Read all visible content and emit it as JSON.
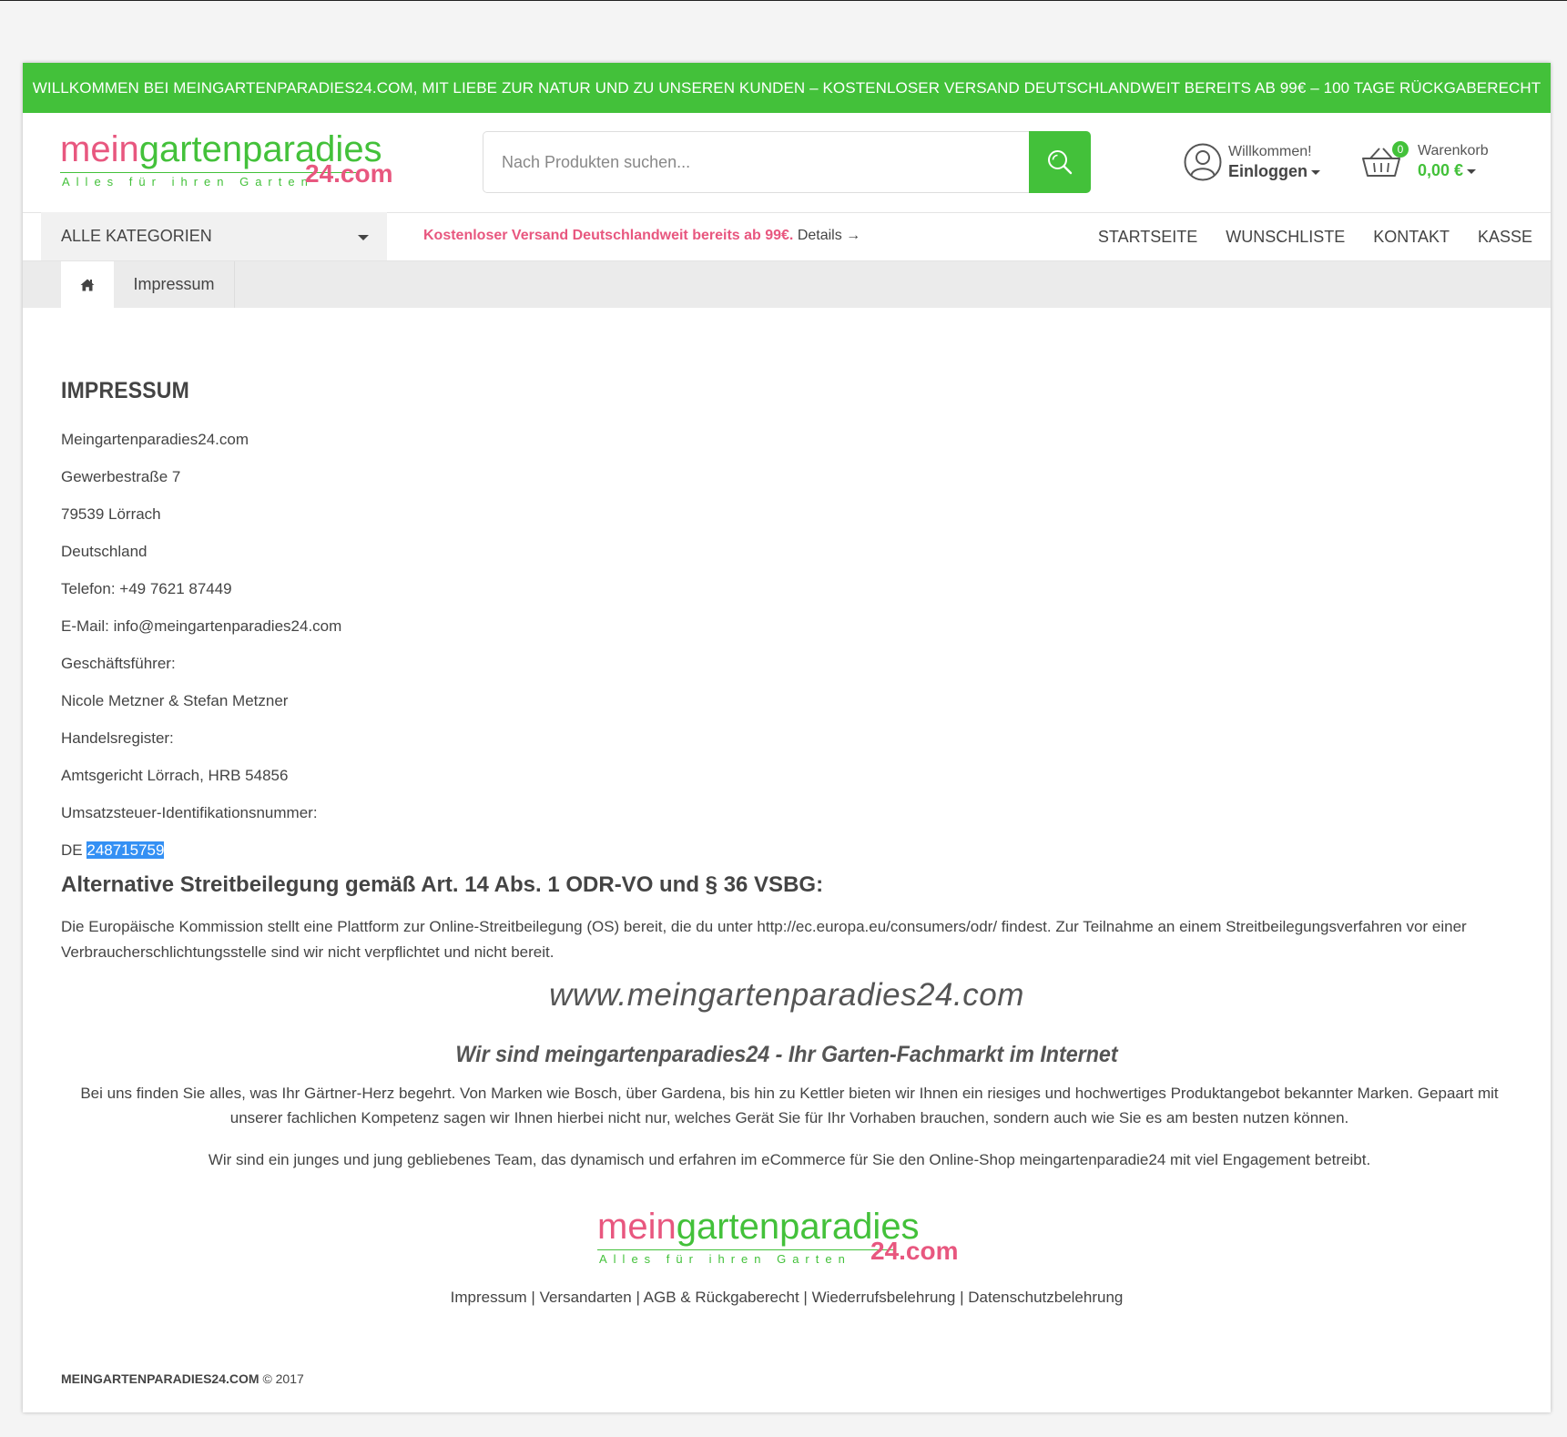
{
  "promo": {
    "text": "WILLKOMMEN BEI MEINGARTENPARADIES24.COM, MIT LIEBE ZUR NATUR UND ZU UNSEREN KUNDEN – KOSTENLOSER VERSAND DEUTSCHLANDWEIT BEREITS AB 99€ – 100 TAGE RÜCKGABERECHT"
  },
  "brand": {
    "colors": {
      "green": "#43c13a",
      "pink": "#e8577f",
      "selection": "#3490f4"
    },
    "logo_mein": "mein",
    "logo_garten": "gartenparadies",
    "logo_tagline": "Alles für ihren Garten",
    "logo_suffix": "24.com"
  },
  "search": {
    "placeholder": "Nach Produkten suchen...",
    "icon": "search-icon"
  },
  "account": {
    "greeting": "Willkommen!",
    "login": "Einloggen",
    "icon": "user-icon"
  },
  "cart": {
    "label": "Warenkorb",
    "total": "0,00 €",
    "count": "0",
    "icon": "basket-icon"
  },
  "nav": {
    "categories": "ALLE KATEGORIEN",
    "shipping_highlight": "Kostenloser Versand Deutschlandweit bereits ab 99€.",
    "shipping_details": "Details →",
    "links": {
      "home": "STARTSEITE",
      "wishlist": "WUNSCHLISTE",
      "contact": "KONTAKT",
      "checkout": "KASSE"
    }
  },
  "breadcrumb": {
    "home_icon": "home-icon",
    "current": "Impressum"
  },
  "impressum": {
    "title": "IMPRESSUM",
    "lines": [
      "Meingartenparadies24.com",
      "Gewerbestraße 7",
      "79539 Lörrach",
      "Deutschland",
      "Telefon: +49 7621 87449",
      "E-Mail: info@meingartenparadies24.com",
      "Geschäftsführer:",
      "Nicole Metzner & Stefan Metzner",
      "Handelsregister:",
      "Amtsgericht Lörrach, HRB 54856",
      "Umsatzsteuer-Identifikationsnummer:"
    ],
    "vat_prefix": "DE",
    "vat_number": "248715759"
  },
  "dispute": {
    "title": "Alternative Streitbeilegung gemäß Art. 14 Abs. 1 ODR-VO und § 36 VSBG:",
    "text": "Die Europäische Kommission stellt eine Plattform zur Online-Streitbeilegung (OS) bereit, die du unter http://ec.europa.eu/consumers/odr/ findest. Zur Teilnahme an einem Streitbeilegungsverfahren vor einer Verbraucherschlichtungsstelle sind wir nicht verpflichtet und nicht bereit."
  },
  "about": {
    "url": "www.meingartenparadies24.com",
    "tagline": "Wir sind meingartenparadies24 - Ihr Garten-Fachmarkt im Internet",
    "paragraph1": "Bei uns finden Sie alles, was Ihr Gärtner-Herz begehrt. Von Marken wie Bosch, über Gardena, bis hin zu Kettler bieten wir Ihnen ein riesiges und hochwertiges Produktangebot bekannter Marken. Gepaart mit unserer fachlichen Kompetenz sagen wir Ihnen hierbei nicht nur, welches Gerät Sie für Ihr Vorhaben brauchen, sondern auch wie Sie es am besten nutzen können.",
    "paragraph2": "Wir sind ein junges und jung gebliebenes Team, das dynamisch und erfahren im eCommerce für Sie den Online-Shop meingartenparadie24 mit viel Engagement betreibt."
  },
  "footer": {
    "links": [
      "Impressum",
      "Versandarten",
      "AGB & Rückgaberecht",
      "Wiederrufsbelehrung",
      "Datenschutzbelehrung"
    ],
    "separator": " | ",
    "brand": "MEINGARTENPARADIES24.COM",
    "copyright": "© 2017"
  }
}
